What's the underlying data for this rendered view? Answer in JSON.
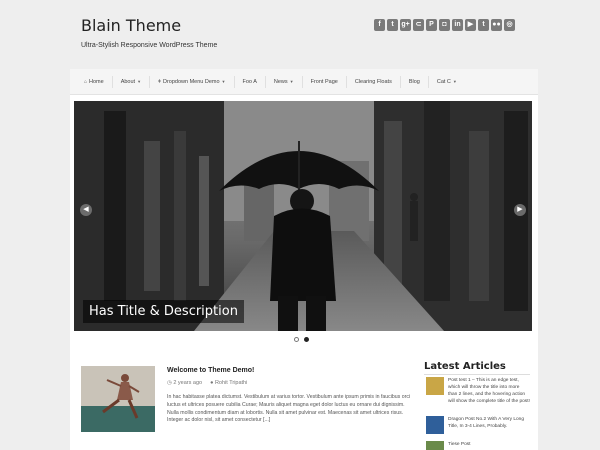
{
  "header": {
    "title": "Blain Theme",
    "tagline": "Ultra-Stylish Responsive WordPress Theme"
  },
  "social": [
    {
      "icon": "facebook-icon",
      "glyph": "f"
    },
    {
      "icon": "twitter-icon",
      "glyph": "t"
    },
    {
      "icon": "google-plus-icon",
      "glyph": "g+"
    },
    {
      "icon": "rss-icon",
      "glyph": "⊂"
    },
    {
      "icon": "pinterest-icon",
      "glyph": "P"
    },
    {
      "icon": "instagram-icon",
      "glyph": "◘"
    },
    {
      "icon": "linkedin-icon",
      "glyph": "in"
    },
    {
      "icon": "youtube-icon",
      "glyph": "▶"
    },
    {
      "icon": "tumblr-icon",
      "glyph": "t"
    },
    {
      "icon": "flickr-icon",
      "glyph": "●●"
    },
    {
      "icon": "dribbble-icon",
      "glyph": "◎"
    }
  ],
  "nav": {
    "home": "Home",
    "about": "About",
    "dropdown": "Dropdown Menu Demo",
    "foo": "Foo A",
    "news": "News",
    "front": "Front Page",
    "floats": "Clearing Floats",
    "blog": "Blog",
    "catc": "Cat C"
  },
  "slider": {
    "caption": "Has Title & Description",
    "prev_glyph": "◀",
    "next_glyph": "▶"
  },
  "post": {
    "title": "Welcome to Theme Demo!",
    "date": "2 years ago",
    "author": "Rohit Tripathi",
    "excerpt": "In hac habitasse platea dictumst. Vestibulum at varius tortor. Vestibulum ante ipsum primis in faucibus orci luctus et ultrices posuere cubilia Curae; Mauris aliquet magna eget dolor luctus eu ornare dui dignissim. Nulla mollis condimentum diam at lobortis. Nulla sit amet pulvinar est. Maecenas sit amet ultrices risus. Integer ac dolor nisl, sit amet consectetur [...]"
  },
  "sidebar": {
    "title": "Latest Articles",
    "articles": [
      {
        "text": "Post test 1 – This is an edge test, which will throw the title into more than 2 lines, and the hovering action will show the complete title of the post!",
        "color": "#c9a646"
      },
      {
        "text": "Dragon Post No.2 With A Very Long Title, In 3-4 Lines, Probably.",
        "color": "#2f5f9a"
      },
      {
        "text": "Tiese Post",
        "color": "#6a8a4a"
      }
    ]
  }
}
